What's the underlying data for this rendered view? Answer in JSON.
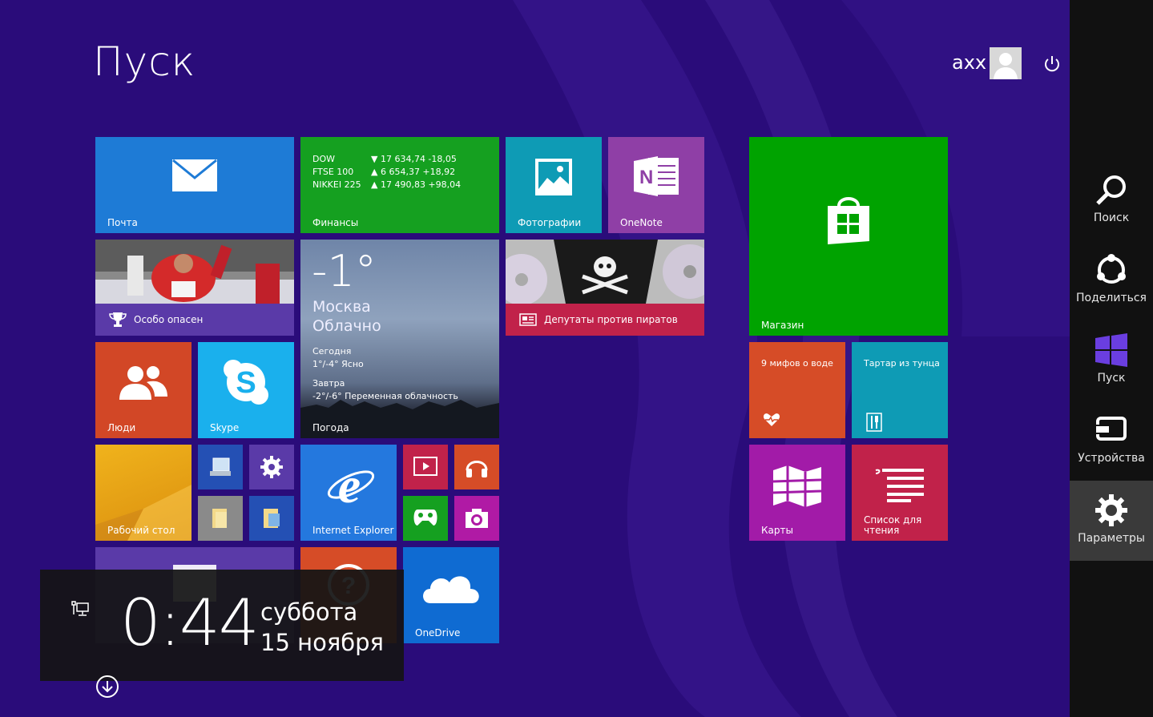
{
  "start_title": "Пуск",
  "user_name": "axx",
  "tiles": {
    "mail": "Почта",
    "finance": {
      "label": "Финансы",
      "rows": [
        {
          "index": "DOW",
          "value": "▼ 17 634,74 -18,05"
        },
        {
          "index": "FTSE 100",
          "value": "▲ 6 654,37 +18,92"
        },
        {
          "index": "NIKKEI 225",
          "value": "▲ 17 490,83 +98,04"
        }
      ]
    },
    "photos": "Фотографии",
    "onenote": "OneNote",
    "store": "Магазин",
    "sport": "Особо опасен",
    "weather": {
      "temp": "-1°",
      "city": "Москва",
      "condition": "Облачно",
      "today_label": "Сегодня",
      "today_value": "1°/-4° Ясно",
      "tomorrow_label": "Завтра",
      "tomorrow_value": "-2°/-6° Переменная облачность",
      "label": "Погода"
    },
    "news": "Депутаты против пиратов",
    "people": "Люди",
    "skype": "Skype",
    "health": "9 мифов о воде",
    "food": "Тартар из тунца",
    "desktop": "Рабочий стол",
    "ie": "Internet Explorer",
    "maps": "Карты",
    "reading_list": "Список для чтения",
    "onedrive": "OneDrive"
  },
  "charms": {
    "search": "Поиск",
    "share": "Поделиться",
    "start": "Пуск",
    "devices": "Устройства",
    "settings": "Параметры"
  },
  "clock": {
    "time": "0:44",
    "day": "суббота",
    "date": "15 ноября"
  },
  "colors": {
    "background": "#2a0c7a",
    "mail": "#1e7bd6",
    "finance": "#15a020",
    "store": "#00a300",
    "photos": "#0e9bb5",
    "onenote": "#8f3fa6",
    "people": "#d24726",
    "skype": "#1ab0ed",
    "desktop": "#e3a21a",
    "health": "#d64c27",
    "food": "#0e9bb5",
    "maps": "#a21ba8",
    "reading_list": "#c1224a",
    "onedrive": "#0f6bd2",
    "ie": "#2478de",
    "charms_bar": "#111111"
  }
}
